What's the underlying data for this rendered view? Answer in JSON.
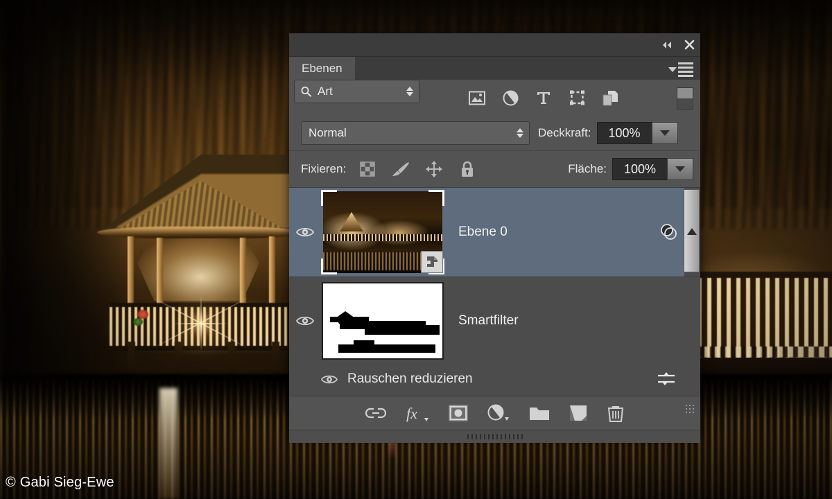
{
  "photo": {
    "description": "Night photograph of an illuminated wooden lakeside pavilion with a pier and water reflections",
    "credit": "© Gabi Sieg-Ewe"
  },
  "panel": {
    "titlebar": {
      "collapse_label": "◀◀",
      "collapse_icon": "double-chevron-left-icon",
      "close_label": "✕",
      "close_icon": "close-icon"
    },
    "tabs": [
      {
        "label": "Ebenen",
        "active": true
      }
    ],
    "menu_icon": "panel-menu-icon",
    "filter_row": {
      "kind_label": "Art",
      "search_icon": "search-icon",
      "filter_icons": [
        "pixel-layer-filter-icon",
        "adjustment-layer-filter-icon",
        "type-layer-filter-icon",
        "shape-layer-filter-icon",
        "smart-object-filter-icon"
      ],
      "toggle_icon": "filter-toggle-switch"
    },
    "blend_row": {
      "blend_mode": "Normal",
      "opacity_label": "Deckkraft:",
      "opacity_value": "100%"
    },
    "lock_row": {
      "lock_label": "Fixieren:",
      "lock_icons": [
        "lock-transparency-icon",
        "lock-image-pixels-icon",
        "lock-position-icon",
        "lock-all-icon"
      ],
      "fill_label": "Fläche:",
      "fill_value": "100%"
    },
    "layers": [
      {
        "name": "Ebene 0",
        "visible": true,
        "selected": true,
        "thumbnail": "layer-thumbnail-photo",
        "badge": "smart-object-badge",
        "right_icon": "smart-filter-icon",
        "eye_icon": "eye-icon"
      },
      {
        "name": "Smartfilter",
        "visible": true,
        "selected": false,
        "thumbnail": "smart-filter-mask-thumbnail",
        "eye_icon": "eye-icon"
      },
      {
        "name": "Rauschen reduzieren",
        "visible": true,
        "selected": false,
        "eye_icon": "eye-icon",
        "right_icon": "filter-settings-icon"
      }
    ],
    "scrollbar": {
      "up_arrow_icon": "scroll-up-arrow-icon"
    },
    "bottom_toolbar": [
      {
        "name": "link-layers-icon",
        "label": "link-layers"
      },
      {
        "name": "layer-style-fx-icon",
        "label": "fx"
      },
      {
        "name": "add-layer-mask-icon",
        "label": "add-layer-mask"
      },
      {
        "name": "new-adjustment-layer-icon",
        "label": "new-adjustment-layer"
      },
      {
        "name": "new-group-icon",
        "label": "new-group"
      },
      {
        "name": "new-layer-icon",
        "label": "new-layer"
      },
      {
        "name": "delete-layer-icon",
        "label": "delete-layer"
      }
    ],
    "footer_grip": "panel-resize-grip"
  },
  "colors": {
    "panel_bg": "#535353",
    "panel_titlebar": "#3c3c3c",
    "list_bg": "#4c4c4c",
    "selected_row": "#5e6c7d",
    "text": "#e6e6e6",
    "field_bg": "#2c2c2c"
  }
}
